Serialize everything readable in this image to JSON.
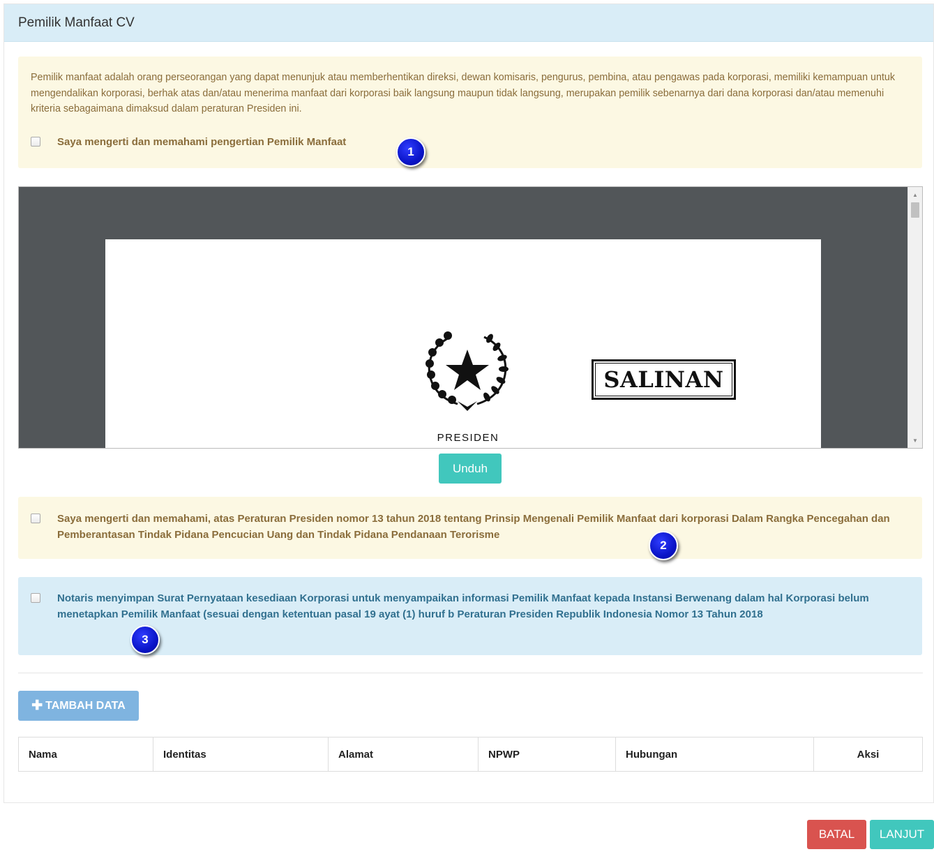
{
  "panel": {
    "title": "Pemilik Manfaat CV"
  },
  "intro": {
    "text": "Pemilik manfaat adalah orang perseorangan yang dapat menunjuk atau memberhentikan direksi, dewan komisaris, pengurus, pembina, atau pengawas pada korporasi, memiliki kemampuan untuk mengendalikan korporasi, berhak atas dan/atau menerima manfaat dari korporasi baik langsung maupun tidak langsung, merupakan pemilik sebenarnya dari dana korporasi dan/atau memenuhi kriteria sebagaimana dimaksud dalam peraturan Presiden ini.",
    "checkbox_label": "Saya mengerti dan memahami pengertian Pemilik Manfaat",
    "checked": false
  },
  "document_viewer": {
    "stamp_text": "SALINAN",
    "caption": "PRESIDEN",
    "emblem_icon": "garuda-star-emblem"
  },
  "download_button": "Unduh",
  "agreement": {
    "label": "Saya mengerti dan memahami, atas Peraturan Presiden nomor 13 tahun 2018 tentang Prinsip Mengenali Pemilik Manfaat dari korporasi Dalam Rangka Pencegahan dan Pemberantasan Tindak Pidana Pencucian Uang dan Tindak Pidana Pendanaan Terorisme",
    "checked": false
  },
  "notary": {
    "label": "Notaris menyimpan Surat Pernyataan kesediaan Korporasi untuk menyampaikan informasi Pemilik Manfaat kepada Instansi Berwenang dalam hal Korporasi belum menetapkan Pemilik Manfaat (sesuai dengan ketentuan pasal 19 ayat (1) huruf b Peraturan Presiden Republik Indonesia Nomor 13 Tahun 2018",
    "checked": false
  },
  "markers": [
    "1",
    "2",
    "3"
  ],
  "add_button": {
    "icon": "plus-icon",
    "label": "TAMBAH DATA"
  },
  "table": {
    "columns": [
      "Nama",
      "Identitas",
      "Alamat",
      "NPWP",
      "Hubungan",
      "Aksi"
    ],
    "rows": []
  },
  "footer": {
    "cancel": "BATAL",
    "next": "LANJUT"
  },
  "colors": {
    "heading_bg": "#d9edf7",
    "warning_bg": "#fcf8e3",
    "warning_text": "#8a6d3b",
    "info_text": "#31708f",
    "teal": "#41c7bd",
    "danger": "#d9534f",
    "primary_disabled": "#7fb4e0",
    "marker_blue": "#0a14c8"
  }
}
